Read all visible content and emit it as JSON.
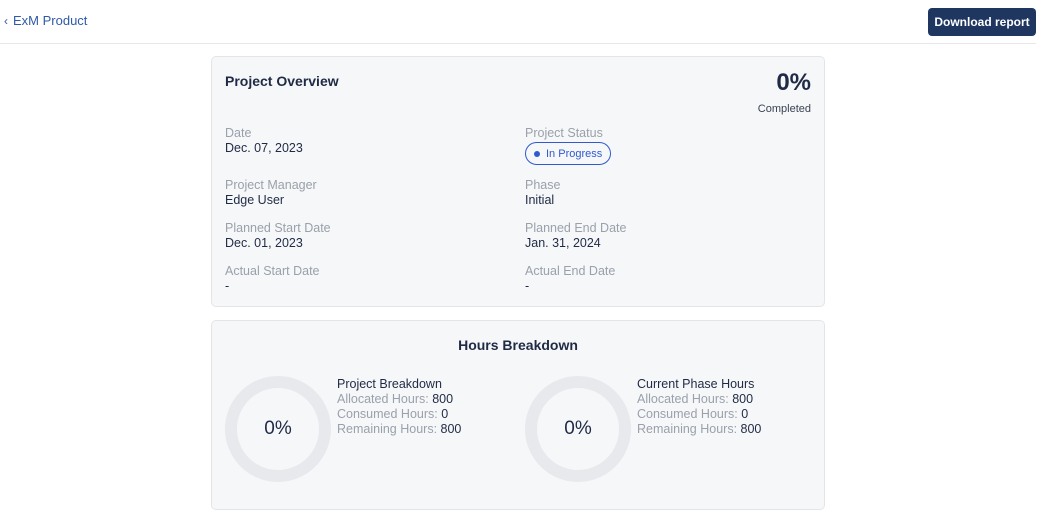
{
  "header": {
    "back_label": "ExM Product",
    "download_label": "Download report"
  },
  "overview": {
    "title": "Project Overview",
    "percent": "0%",
    "percent_caption": "Completed",
    "percent_value": 0,
    "fields": {
      "date": {
        "label": "Date",
        "value": "Dec. 07, 2023"
      },
      "status": {
        "label": "Project Status",
        "value": "In Progress"
      },
      "manager": {
        "label": "Project Manager",
        "value": "Edge User"
      },
      "phase": {
        "label": "Phase",
        "value": "Initial"
      },
      "planned_start": {
        "label": "Planned Start Date",
        "value": "Dec. 01, 2023"
      },
      "planned_end": {
        "label": "Planned End Date",
        "value": "Jan. 31, 2024"
      },
      "actual_start": {
        "label": "Actual Start Date",
        "value": "-"
      },
      "actual_end": {
        "label": "Actual End Date",
        "value": "-"
      }
    }
  },
  "hours": {
    "title": "Hours Breakdown",
    "project": {
      "percent": "0%",
      "title": "Project Breakdown",
      "allocated_label": "Allocated Hours:",
      "allocated": "800",
      "consumed_label": "Consumed Hours:",
      "consumed": "0",
      "remaining_label": "Remaining Hours:",
      "remaining": "800"
    },
    "phase": {
      "percent": "0%",
      "title": "Current Phase Hours",
      "allocated_label": "Allocated Hours:",
      "allocated": "800",
      "consumed_label": "Consumed Hours:",
      "consumed": "0",
      "remaining_label": "Remaining Hours:",
      "remaining": "800"
    }
  },
  "colors": {
    "accent": "#1e3660",
    "link": "#2f5aa8",
    "status": "#2f5ad0",
    "muted": "#9aa1ab"
  },
  "icons": {
    "back": "chevron-left-icon",
    "status_dot": "status-dot-icon"
  }
}
